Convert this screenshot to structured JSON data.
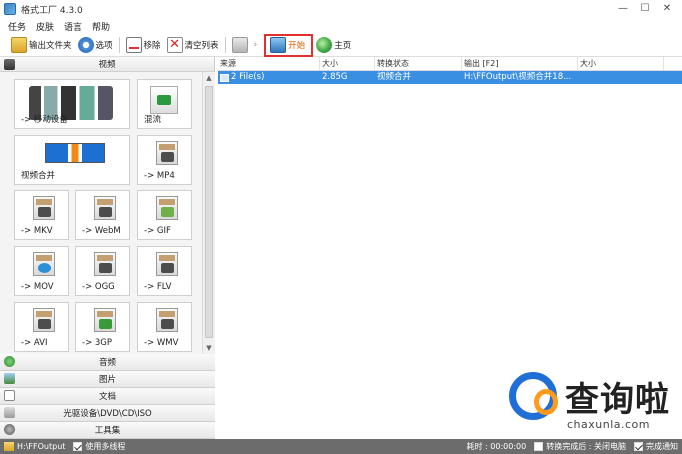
{
  "window": {
    "title": "格式工厂 4.3.0",
    "min": "—",
    "max": "☐",
    "close": "✕"
  },
  "menu": [
    "任务",
    "皮肤",
    "语言",
    "帮助"
  ],
  "toolbar": {
    "output_folder": "输出文件夹",
    "options": "选项",
    "remove": "移除",
    "clear_list": "清空列表",
    "start": "开始",
    "home": "主页"
  },
  "sections": {
    "video": "视频",
    "audio": "音频",
    "picture": "图片",
    "document": "文档",
    "disc": "光驱设备\\DVD\\CD\\ISO",
    "tools": "工具集"
  },
  "tiles": [
    {
      "label": "-> 移动设备"
    },
    {
      "label": "混流"
    },
    {
      "label": "视频合并"
    },
    {
      "label": "-> MP4"
    },
    {
      "label": "-> MKV"
    },
    {
      "label": "-> WebM"
    },
    {
      "label": "-> GIF"
    },
    {
      "label": "-> MOV"
    },
    {
      "label": "-> OGG"
    },
    {
      "label": "-> FLV"
    },
    {
      "label": "-> AVI"
    },
    {
      "label": "-> 3GP"
    },
    {
      "label": "-> WMV"
    }
  ],
  "tile_icons": {
    "mp4": "MP4",
    "gif": "GIF",
    "mov": "MOV",
    "flv": "FLV",
    "avi": "AVI",
    "wmv": "WMV"
  },
  "filelist": {
    "columns": [
      "来源",
      "大小",
      "转换状态",
      "输出 [F2]",
      "大小"
    ],
    "rows": [
      {
        "source": "2 File(s)",
        "size": "2.85G",
        "status": "视频合并",
        "output": "H:\\FFOutput\\视频合并18...",
        "out_size": ""
      }
    ]
  },
  "statusbar": {
    "output_path": "H:\\FFOutput",
    "multithread": "使用多线程",
    "elapsed": "耗时 : 00:00:00",
    "after_convert": "转换完成后 : 关闭电脑",
    "notify": "完成通知"
  },
  "watermark": {
    "cn": "查询啦",
    "en": "chaxunla.com"
  }
}
